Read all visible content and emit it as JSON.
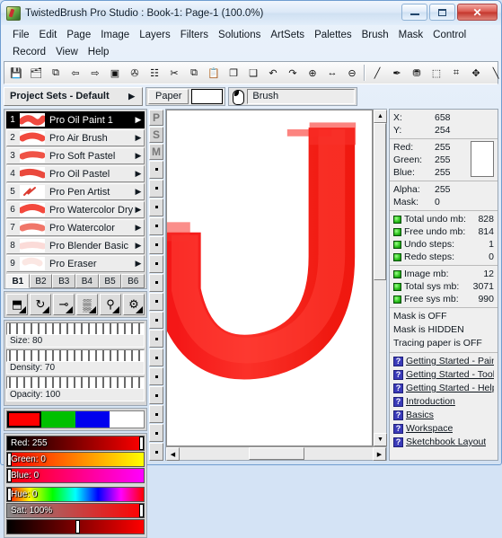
{
  "window": {
    "title": "TwistedBrush Pro Studio : Book-1: Page-1 (100.0%)",
    "app_icon": "twistedbrush-logo-icon",
    "minimize_label": "Minimize",
    "maximize_label": "Maximize",
    "close_label": "✕"
  },
  "menubar": {
    "items": [
      {
        "label": "File"
      },
      {
        "label": "Edit"
      },
      {
        "label": "Page"
      },
      {
        "label": "Image"
      },
      {
        "label": "Layers"
      },
      {
        "label": "Filters"
      },
      {
        "label": "Solutions"
      },
      {
        "label": "ArtSets"
      },
      {
        "label": "Palettes"
      },
      {
        "label": "Brush"
      },
      {
        "label": "Mask"
      },
      {
        "label": "Control"
      },
      {
        "label": "Record"
      },
      {
        "label": "View"
      },
      {
        "label": "Help"
      }
    ]
  },
  "toolbar": {
    "buttons": [
      {
        "icon": "save-icon",
        "glyph": "💾"
      },
      {
        "icon": "save-all-icon",
        "glyph": "🗂"
      },
      {
        "icon": "page-new-icon",
        "glyph": "⧉"
      },
      {
        "icon": "page-prev-icon",
        "glyph": "⇦"
      },
      {
        "icon": "page-next-icon",
        "glyph": "⇨"
      },
      {
        "icon": "page-open-icon",
        "glyph": "▣"
      },
      {
        "icon": "clear-page-icon",
        "glyph": "✇"
      },
      {
        "icon": "layers-icon",
        "glyph": "☷"
      },
      {
        "icon": "cut-icon",
        "glyph": "✂"
      },
      {
        "icon": "copy-icon",
        "glyph": "⧉"
      },
      {
        "icon": "paste-icon",
        "glyph": "📋"
      },
      {
        "icon": "copy-layer-icon",
        "glyph": "❐"
      },
      {
        "icon": "paste-layer-icon",
        "glyph": "❑"
      },
      {
        "icon": "undo-icon",
        "glyph": "↶"
      },
      {
        "icon": "redo-icon",
        "glyph": "↷"
      },
      {
        "icon": "zoom-in-icon",
        "glyph": "⊕"
      },
      {
        "icon": "zoom-fit-icon",
        "glyph": "↔"
      },
      {
        "icon": "zoom-out-icon",
        "glyph": "⊖"
      }
    ],
    "tools": [
      {
        "icon": "paintbrush-tool-icon",
        "glyph": "╱"
      },
      {
        "icon": "eyedropper-tool-icon",
        "glyph": "✒"
      },
      {
        "icon": "paint-bucket-tool-icon",
        "glyph": "⛃"
      },
      {
        "icon": "selection-tool-icon",
        "glyph": "⬚"
      },
      {
        "icon": "crop-tool-icon",
        "glyph": "⌗"
      },
      {
        "icon": "move-tool-icon",
        "glyph": "✥"
      },
      {
        "icon": "line-tool-icon",
        "glyph": "╲"
      },
      {
        "icon": "shape-tool-icon",
        "glyph": "▭"
      }
    ]
  },
  "subbar": {
    "project_sets_label": "Project Sets - Default",
    "project_sets_arrow": "▶",
    "paper_label": "Paper",
    "paper_color": "#ffffff",
    "brush_icon": "brush-preset-icon",
    "brush_value": "Brush"
  },
  "brush_panel": {
    "brushes": [
      {
        "num": "1",
        "name": "Pro Oil Paint 1",
        "selected": true,
        "swatch": "#ef3b30"
      },
      {
        "num": "2",
        "name": "Pro Air Brush",
        "selected": false,
        "swatch": "#f03a2e"
      },
      {
        "num": "3",
        "name": "Pro Soft Pastel",
        "selected": false,
        "swatch": "#ee4436"
      },
      {
        "num": "4",
        "name": "Pro Oil Pastel",
        "selected": false,
        "swatch": "#e83a2c"
      },
      {
        "num": "5",
        "name": "Pro Pen Artist",
        "selected": false,
        "swatch": "#d92b20"
      },
      {
        "num": "6",
        "name": "Pro Watercolor Dry",
        "selected": false,
        "swatch": "#f23a2c"
      },
      {
        "num": "7",
        "name": "Pro Watercolor",
        "selected": false,
        "swatch": "#ef6a5c"
      },
      {
        "num": "8",
        "name": "Pro Blender Basic",
        "selected": false,
        "swatch": "#f6b0a8"
      },
      {
        "num": "9",
        "name": "Pro Eraser",
        "selected": false,
        "swatch": "#f6c9c2"
      }
    ],
    "caret": "▶",
    "tabs": [
      {
        "label": "B1",
        "selected": true
      },
      {
        "label": "B2",
        "selected": false
      },
      {
        "label": "B3",
        "selected": false
      },
      {
        "label": "B4",
        "selected": false
      },
      {
        "label": "B5",
        "selected": false
      },
      {
        "label": "B6",
        "selected": false
      }
    ]
  },
  "brush_tools": {
    "buttons": [
      {
        "icon": "flip-brush-icon",
        "glyph": "⬒"
      },
      {
        "icon": "rotate-brush-icon",
        "glyph": "↻"
      },
      {
        "icon": "brush-shape-icon",
        "glyph": "⊸"
      },
      {
        "icon": "brush-texture-icon",
        "glyph": "▒"
      },
      {
        "icon": "spray-brush-icon",
        "glyph": "⚲"
      },
      {
        "icon": "brush-settings-icon",
        "glyph": "⚙"
      }
    ]
  },
  "brush_sliders": [
    {
      "name": "size",
      "label": "Size: 80",
      "value": 80,
      "max": 100
    },
    {
      "name": "density",
      "label": "Density: 70",
      "value": 70,
      "max": 100
    },
    {
      "name": "opacity",
      "label": "Opacity: 100",
      "value": 100,
      "max": 100
    }
  ],
  "color_panel": {
    "swatches": [
      {
        "name": "red",
        "color": "#ff0000",
        "current": true
      },
      {
        "name": "green",
        "color": "#00c000",
        "current": false
      },
      {
        "name": "blue",
        "color": "#0000ee",
        "current": false
      },
      {
        "name": "white",
        "color": "#ffffff",
        "current": false
      }
    ],
    "channels": [
      {
        "name": "red",
        "label": "Red: 255",
        "value": 255,
        "max": 255,
        "gradient": "linear-gradient(90deg,#000 0%,#ff0000 100%)"
      },
      {
        "name": "green",
        "label": "Green: 0",
        "value": 0,
        "max": 255,
        "gradient": "linear-gradient(90deg,#ff0000 0%,#ffff00 100%)"
      },
      {
        "name": "blue",
        "label": "Blue: 0",
        "value": 0,
        "max": 255,
        "gradient": "linear-gradient(90deg,#ff0000 0%,#ff00ff 100%)"
      }
    ],
    "hsv": [
      {
        "name": "hue",
        "label": "Hue: 0",
        "value": 0,
        "max": 360,
        "gradient": "linear-gradient(90deg,#ff0000,#ffff00,#00ff00,#00ffff,#0000ff,#ff00ff,#ff0000)"
      },
      {
        "name": "sat",
        "label": "Sat: 100%",
        "value": 100,
        "max": 100,
        "gradient": "linear-gradient(90deg,#8a8a8a 0%,#ff0000 100%)"
      },
      {
        "name": "val",
        "label": "",
        "value": 50,
        "max": 100,
        "gradient": "linear-gradient(90deg,#000 0%,#ff0000 100%)"
      }
    ]
  },
  "psm_strip": {
    "tabs": [
      {
        "label": "P",
        "name": "paper-tab"
      },
      {
        "label": "S",
        "name": "sets-tab"
      },
      {
        "label": "M",
        "name": "mask-tab"
      }
    ],
    "dot_count": 16,
    "dot_glyph": "·"
  },
  "canvas": {
    "background": "#ffffff",
    "stroke_color": "#fa1e18",
    "stroke_shape": "letter-j-brush-stroke",
    "scroll_up": "▲",
    "scroll_down": "▼",
    "scroll_left": "◀",
    "scroll_right": "▶"
  },
  "info_panel": {
    "cursor": [
      {
        "key": "X:",
        "value": "658"
      },
      {
        "key": "Y:",
        "value": "254"
      }
    ],
    "rgb": [
      {
        "key": "Red:",
        "value": "255"
      },
      {
        "key": "Green:",
        "value": "255"
      },
      {
        "key": "Blue:",
        "value": "255"
      }
    ],
    "rgb_preview_color": "#ffffff",
    "alpha": [
      {
        "key": "Alpha:",
        "value": "255"
      },
      {
        "key": "Mask:",
        "value": "0"
      }
    ],
    "memory": [
      {
        "name": "Total undo mb:",
        "value": "828"
      },
      {
        "name": "Free undo mb:",
        "value": "814"
      },
      {
        "name": "Undo steps:",
        "value": "1"
      },
      {
        "name": "Redo steps:",
        "value": "0"
      }
    ],
    "memory2": [
      {
        "name": "Image mb:",
        "value": "12"
      },
      {
        "name": "Total sys mb:",
        "value": "3071"
      },
      {
        "name": "Free sys mb:",
        "value": "990"
      }
    ],
    "status": [
      "Mask is OFF",
      "Mask is HIDDEN",
      "Tracing paper is OFF"
    ],
    "help_icon_glyph": "?",
    "help_links": [
      "Getting Started - Painti",
      "Getting Started - Tools",
      "Getting Started - Help",
      "Introduction",
      "Basics",
      "Workspace",
      "Sketchbook Layout"
    ]
  }
}
